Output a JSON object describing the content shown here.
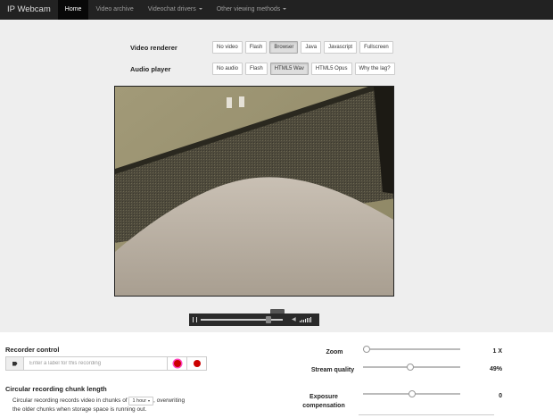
{
  "nav": {
    "brand": "IP Webcam",
    "items": [
      {
        "label": "Home",
        "active": true,
        "dropdown": false
      },
      {
        "label": "Video archive",
        "active": false,
        "dropdown": false
      },
      {
        "label": "Videochat drivers",
        "active": false,
        "dropdown": true
      },
      {
        "label": "Other viewing methods",
        "active": false,
        "dropdown": true
      }
    ]
  },
  "video_renderer": {
    "label": "Video renderer",
    "options": [
      "No video",
      "Flash",
      "Browser",
      "Java",
      "Javascript",
      "Fullscreen"
    ],
    "selected": "Browser"
  },
  "audio_player": {
    "label": "Audio player",
    "options": [
      "No audio",
      "Flash",
      "HTML5 Wav",
      "HTML5 Opus",
      "Why the lag?"
    ],
    "selected": "HTML5 Wav"
  },
  "player": {
    "progress": 0.85,
    "volume_icon": "speaker-icon"
  },
  "recorder": {
    "title": "Recorder control",
    "placeholder": "Enter a label for this recording"
  },
  "circular": {
    "title": "Circular recording chunk length",
    "text_before": "Circular recording records video in chunks of",
    "chunk": "1 hour",
    "text_after": ", overwriting",
    "text_line2": "the older chunks when storage space is running out."
  },
  "sliders": {
    "zoom": {
      "label": "Zoom",
      "value": "1 X",
      "position": 0.0
    },
    "quality": {
      "label": "Stream quality",
      "value": "49%",
      "position": 0.49
    },
    "exposure": {
      "label": "Exposure compensation",
      "value": "0",
      "position": 0.5
    }
  },
  "colors": {
    "navbar": "#222222",
    "record": "#cc0000"
  }
}
